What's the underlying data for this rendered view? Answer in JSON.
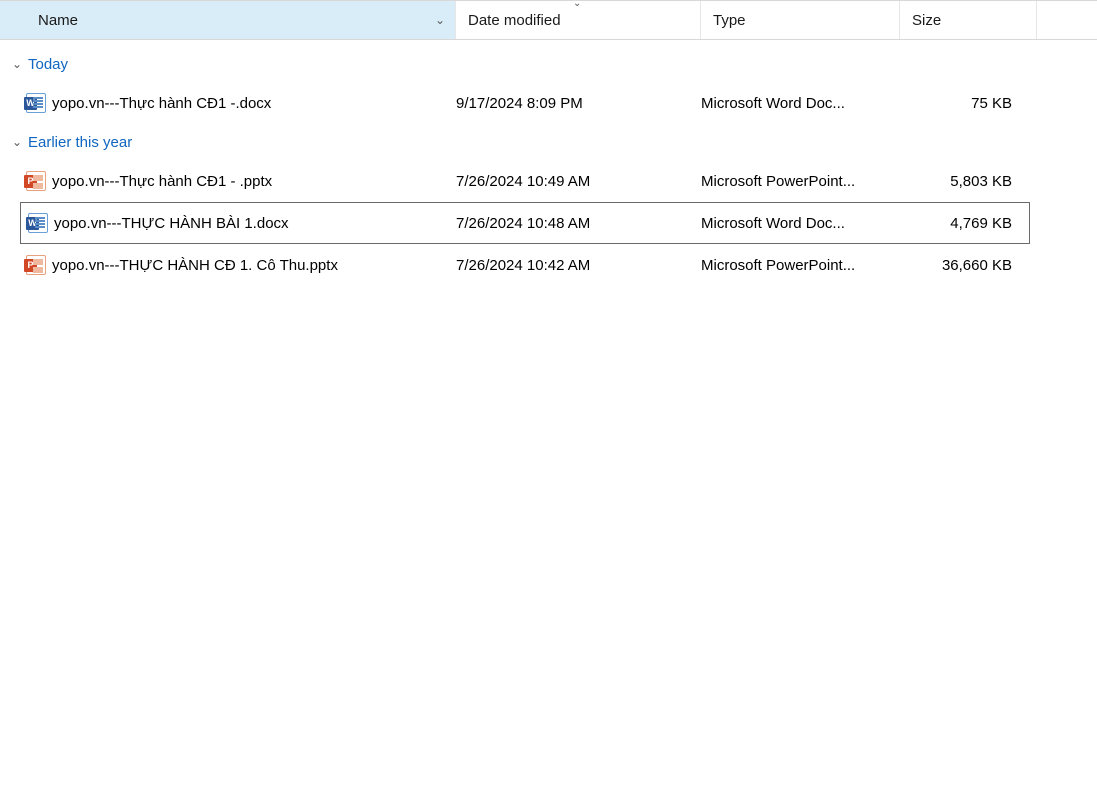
{
  "columns": {
    "name": "Name",
    "date": "Date modified",
    "type": "Type",
    "size": "Size"
  },
  "groups": [
    {
      "label": "Today",
      "files": [
        {
          "icon": "docx",
          "name": "yopo.vn---Thực hành CĐ1 -.docx",
          "date": "9/17/2024 8:09 PM",
          "type": "Microsoft Word Doc...",
          "size": "75 KB",
          "selected": false
        }
      ]
    },
    {
      "label": "Earlier this year",
      "files": [
        {
          "icon": "pptx",
          "name": "yopo.vn---Thực hành CĐ1 - .pptx",
          "date": "7/26/2024 10:49 AM",
          "type": "Microsoft PowerPoint...",
          "size": "5,803 KB",
          "selected": false
        },
        {
          "icon": "docx",
          "name": "yopo.vn---THỰC HÀNH BÀI 1.docx",
          "date": "7/26/2024 10:48 AM",
          "type": "Microsoft Word Doc...",
          "size": "4,769 KB",
          "selected": true
        },
        {
          "icon": "pptx",
          "name": "yopo.vn---THỰC HÀNH CĐ 1. Cô Thu.pptx",
          "date": "7/26/2024 10:42 AM",
          "type": "Microsoft PowerPoint...",
          "size": "36,660 KB",
          "selected": false
        }
      ]
    }
  ]
}
